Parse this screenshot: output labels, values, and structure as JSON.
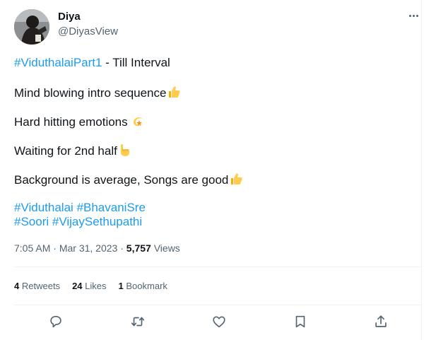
{
  "author": {
    "display_name": "Diya",
    "username": "@DiyasView"
  },
  "tweet": {
    "line1_hashtag": "#ViduthalaiPart1",
    "line1_text": " - Till Interval",
    "line2": "Mind blowing intro sequence",
    "line3": "Hard hitting emotions ",
    "line4": "Waiting for 2nd half",
    "line5": "Background is average, Songs are good",
    "hashtags_line1": [
      "#Viduthalai",
      "#BhavaniSre"
    ],
    "hashtags_line2": [
      "#Soori",
      "#VijaySethupathi"
    ]
  },
  "meta": {
    "time": "7:05 AM",
    "date": "Mar 31, 2023",
    "views_count": "5,757",
    "views_label": "Views",
    "separator": " · "
  },
  "stats": {
    "retweets_count": "4",
    "retweets_label": "Retweets",
    "likes_count": "24",
    "likes_label": "Likes",
    "bookmarks_count": "1",
    "bookmarks_label": "Bookmark"
  },
  "actions": [
    "reply-icon",
    "retweet-icon",
    "like-icon",
    "bookmark-icon",
    "share-icon"
  ],
  "colors": {
    "hashtag": "#1d9bf0",
    "text": "#0f1419",
    "secondary": "#536471",
    "border": "#eff3f4",
    "emoji": "#f5b100"
  }
}
